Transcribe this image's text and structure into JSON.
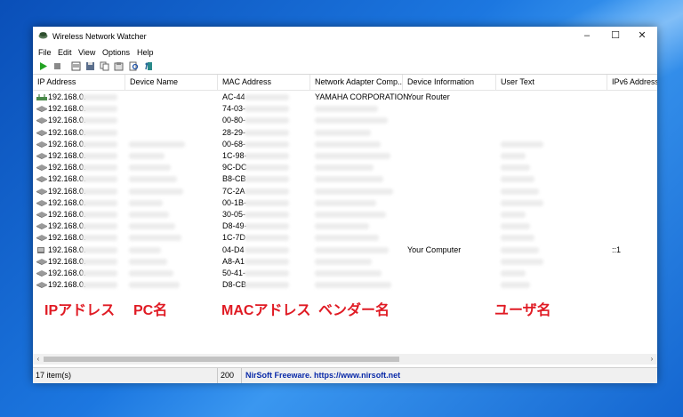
{
  "window": {
    "title": "Wireless Network Watcher"
  },
  "menu": [
    "File",
    "Edit",
    "View",
    "Options",
    "Help"
  ],
  "toolbar": {
    "icons": [
      "play-icon",
      "stop-icon",
      "html-report-icon",
      "save-icon",
      "copy-icon",
      "properties-icon",
      "find-icon",
      "exit-icon"
    ]
  },
  "columns": [
    "IP Address",
    "Device Name",
    "MAC Address",
    "Network Adapter Comp...",
    "Device Information",
    "User Text",
    "IPv6 Address"
  ],
  "rows": [
    {
      "ip": "192.168.0.",
      "mac": "AC-44",
      "vendor": "YAMAHA CORPORATION",
      "info": "Your Router",
      "ipv6": "",
      "icon": "router"
    },
    {
      "ip": "192.168.0.",
      "mac": "74-03-",
      "vendor": "",
      "info": "",
      "ipv6": "",
      "icon": "device"
    },
    {
      "ip": "192.168.0.",
      "mac": "00-80-",
      "vendor": "",
      "info": "",
      "ipv6": "",
      "icon": "device"
    },
    {
      "ip": "192.168.0.",
      "mac": "28-29-",
      "vendor": "",
      "info": "",
      "ipv6": "",
      "icon": "device"
    },
    {
      "ip": "192.168.0.",
      "mac": "00-68-",
      "vendor": "",
      "info": "",
      "ipv6": "",
      "icon": "device"
    },
    {
      "ip": "192.168.0.",
      "mac": "1C-98-",
      "vendor": "",
      "info": "",
      "ipv6": "",
      "icon": "device"
    },
    {
      "ip": "192.168.0.",
      "mac": "9C-DC",
      "vendor": "",
      "info": "",
      "ipv6": "",
      "icon": "device"
    },
    {
      "ip": "192.168.0.",
      "mac": "B8-CB",
      "vendor": "",
      "info": "",
      "ipv6": "",
      "icon": "device"
    },
    {
      "ip": "192.168.0.",
      "mac": "7C-2A",
      "vendor": "",
      "info": "",
      "ipv6": "",
      "icon": "device"
    },
    {
      "ip": "192.168.0.",
      "mac": "00-1B-",
      "vendor": "",
      "info": "",
      "ipv6": "",
      "icon": "device"
    },
    {
      "ip": "192.168.0.",
      "mac": "30-05-",
      "vendor": "",
      "info": "",
      "ipv6": "",
      "icon": "device"
    },
    {
      "ip": "192.168.0.",
      "mac": "D8-49-",
      "vendor": "",
      "info": "",
      "ipv6": "",
      "icon": "device"
    },
    {
      "ip": "192.168.0.",
      "mac": "1C-7D",
      "vendor": "",
      "info": "",
      "ipv6": "",
      "icon": "device"
    },
    {
      "ip": "192.168.0.",
      "mac": "04-D4",
      "vendor": "",
      "info": "Your Computer",
      "ipv6": "::1",
      "icon": "computer"
    },
    {
      "ip": "192.168.0.",
      "mac": "A8-A1",
      "vendor": "",
      "info": "",
      "ipv6": "",
      "icon": "device"
    },
    {
      "ip": "192.168.0.",
      "mac": "50-41-",
      "vendor": "",
      "info": "",
      "ipv6": "",
      "icon": "device"
    },
    {
      "ip": "192.168.0.",
      "mac": "D8-CB",
      "vendor": "",
      "info": "",
      "ipv6": "",
      "icon": "device"
    }
  ],
  "captions": {
    "ip": "IPアドレス",
    "pc": "PC名",
    "mac": "MACアドレス",
    "vendor": "ベンダー名",
    "user": "ユーザ名"
  },
  "status": {
    "items": "17 item(s)",
    "count": "200",
    "freeware": "NirSoft Freeware. https://www.nirsoft.net"
  },
  "colors": {
    "caption": "#e01b24",
    "status_link": "#0a2aa8",
    "desktop": "#1c77e0"
  }
}
